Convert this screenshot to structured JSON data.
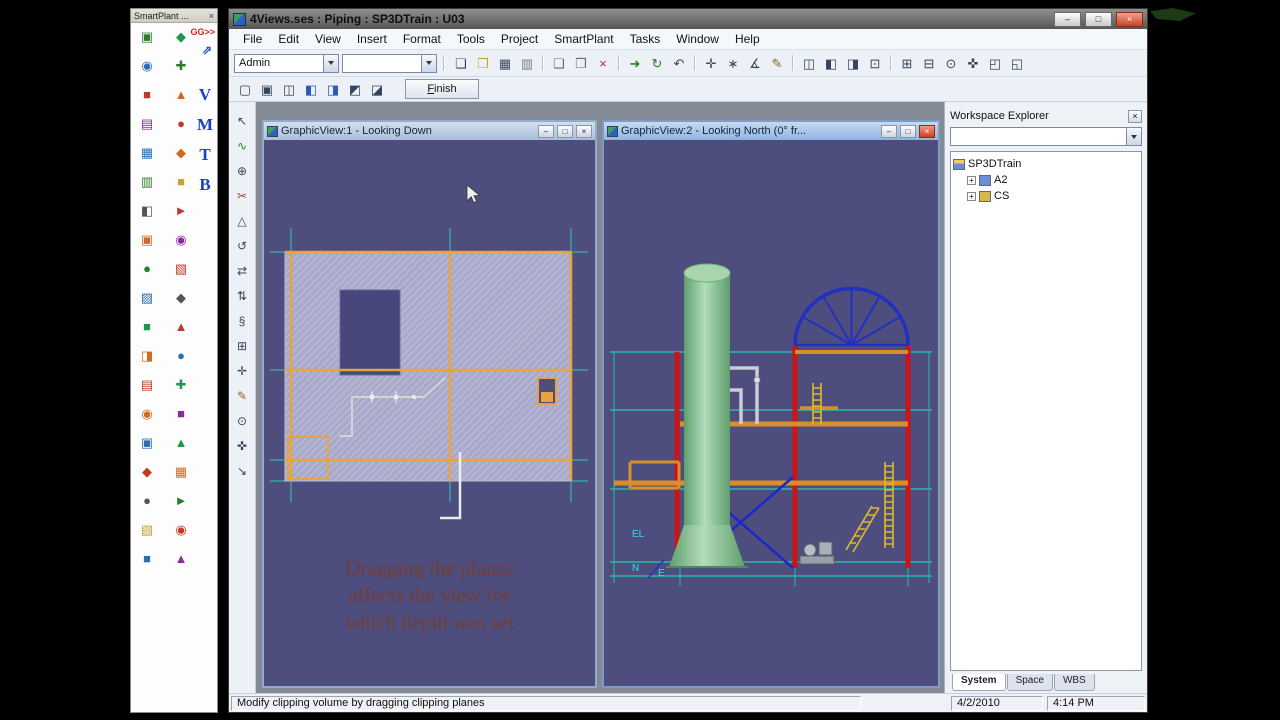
{
  "colors": {
    "canvas_background": "#4e4e7e",
    "accent_orange": "#e8a33d",
    "accent_teal": "#2cb8a8",
    "column_red": "#cc1414",
    "vessel_green": "#8fc49a",
    "dome_blue": "#2230c0",
    "overlay_text": "#7a3a2a"
  },
  "chrome": {
    "minimize": "–",
    "maximize": "□",
    "close": "×"
  },
  "palette": {
    "title": "SmartPlant ...",
    "gg_label": "GG>>",
    "jump_glyph": "⇗",
    "letters": [
      "V",
      "M",
      "T",
      "B"
    ],
    "icons": [
      {
        "g": "▣",
        "c": "#2a7d2a"
      },
      {
        "g": "◆",
        "c": "#1a9a4a"
      },
      {
        "g": "◉",
        "c": "#2a6db5"
      },
      {
        "g": "✚",
        "c": "#2a7d2a"
      },
      {
        "g": "■",
        "c": "#c03a2a"
      },
      {
        "g": "▲",
        "c": "#d2691e"
      },
      {
        "g": "▤",
        "c": "#8a2aa0"
      },
      {
        "g": "●",
        "c": "#c03a2a"
      },
      {
        "g": "▦",
        "c": "#2a6db5"
      },
      {
        "g": "◆",
        "c": "#d2691e"
      },
      {
        "g": "▥",
        "c": "#2a7d2a"
      },
      {
        "g": "■",
        "c": "#c9a23b"
      },
      {
        "g": "◧",
        "c": "#555555"
      },
      {
        "g": "►",
        "c": "#c03a2a"
      },
      {
        "g": "▣",
        "c": "#d2691e"
      },
      {
        "g": "◉",
        "c": "#8a2aa0"
      },
      {
        "g": "●",
        "c": "#2a7d2a"
      },
      {
        "g": "▧",
        "c": "#c03a2a"
      },
      {
        "g": "▨",
        "c": "#2a6db5"
      },
      {
        "g": "◆",
        "c": "#555555"
      },
      {
        "g": "■",
        "c": "#1a9a4a"
      },
      {
        "g": "▲",
        "c": "#c03a2a"
      },
      {
        "g": "◨",
        "c": "#d2691e"
      },
      {
        "g": "●",
        "c": "#2a6db5"
      },
      {
        "g": "▤",
        "c": "#c03a2a"
      },
      {
        "g": "✚",
        "c": "#1a9a4a"
      },
      {
        "g": "◉",
        "c": "#d2691e"
      },
      {
        "g": "■",
        "c": "#8a2aa0"
      },
      {
        "g": "▣",
        "c": "#2a6db5"
      },
      {
        "g": "▲",
        "c": "#1a9a4a"
      },
      {
        "g": "◆",
        "c": "#c03a2a"
      },
      {
        "g": "▦",
        "c": "#d2691e"
      },
      {
        "g": "●",
        "c": "#555555"
      },
      {
        "g": "►",
        "c": "#2a7d2a"
      },
      {
        "g": "▧",
        "c": "#c9a23b"
      },
      {
        "g": "◉",
        "c": "#c03a2a"
      },
      {
        "g": "■",
        "c": "#2a6db5"
      },
      {
        "g": "▲",
        "c": "#8a2aa0"
      }
    ]
  },
  "window": {
    "title": "4Views.ses : Piping : SP3DTrain : U03"
  },
  "menu": {
    "items": [
      "File",
      "Edit",
      "View",
      "Insert",
      "Format",
      "Tools",
      "Project",
      "SmartPlant",
      "Tasks",
      "Window",
      "Help"
    ]
  },
  "toolbars": {
    "permission_group": "Admin",
    "locate_filter": "",
    "finish": "Finish",
    "main_icons": [
      {
        "name": "new-document",
        "g": "❏",
        "c": "#35455e"
      },
      {
        "name": "open",
        "g": "❐",
        "c": "#c9a23b"
      },
      {
        "name": "save",
        "g": "▦",
        "c": "#35455e"
      },
      {
        "name": "print",
        "g": "▥",
        "c": "#6a7a94"
      },
      {
        "sep": true
      },
      {
        "name": "copy",
        "g": "❑",
        "c": "#5b6b85"
      },
      {
        "name": "paste",
        "g": "❒",
        "c": "#5b6b85"
      },
      {
        "name": "delete",
        "g": "×",
        "c": "#aa3333"
      },
      {
        "sep": true
      },
      {
        "name": "move",
        "g": "➜",
        "c": "#2a7d2a"
      },
      {
        "name": "rotate",
        "g": "↻",
        "c": "#2a7d2a"
      },
      {
        "name": "undo",
        "g": "↶",
        "c": "#35455e"
      },
      {
        "sep": true
      },
      {
        "name": "pinpoint",
        "g": "✛",
        "c": "#35455e"
      },
      {
        "name": "point-along",
        "g": "∗",
        "c": "#35455e"
      },
      {
        "name": "measure",
        "g": "∡",
        "c": "#35455e"
      },
      {
        "name": "sketch",
        "g": "✎",
        "c": "#8a6a2a"
      },
      {
        "sep": true
      },
      {
        "name": "view-properties",
        "g": "◫",
        "c": "#35455e"
      },
      {
        "name": "split-view",
        "g": "◧",
        "c": "#35455e"
      },
      {
        "name": "window-layout",
        "g": "◨",
        "c": "#35455e"
      },
      {
        "name": "view-box",
        "g": "⊡",
        "c": "#35455e"
      },
      {
        "sep": true
      },
      {
        "name": "zoom-in",
        "g": "⊞",
        "c": "#35455e"
      },
      {
        "name": "zoom-out",
        "g": "⊟",
        "c": "#35455e"
      },
      {
        "name": "zoom-tool",
        "g": "⊙",
        "c": "#35455e"
      },
      {
        "name": "pan",
        "g": "✜",
        "c": "#35455e"
      },
      {
        "name": "fit-view",
        "g": "◰",
        "c": "#35455e"
      },
      {
        "name": "previous-view",
        "g": "◱",
        "c": "#35455e"
      }
    ],
    "view_icons": [
      {
        "name": "clip-option-1",
        "g": "▢",
        "c": "#35455e"
      },
      {
        "name": "clip-option-2",
        "g": "▣",
        "c": "#35455e"
      },
      {
        "name": "clip-option-3",
        "g": "◫",
        "c": "#35455e"
      },
      {
        "name": "clip-option-4",
        "g": "◧",
        "c": "#2a5db0"
      },
      {
        "name": "clip-option-5",
        "g": "◨",
        "c": "#2a5db0"
      },
      {
        "name": "clip-option-6",
        "g": "◩",
        "c": "#35455e"
      },
      {
        "name": "clip-option-7",
        "g": "◪",
        "c": "#35455e"
      }
    ],
    "vertical_icons": [
      {
        "name": "select-tool",
        "g": "↖",
        "c": "#35455e"
      },
      {
        "name": "route-pipe",
        "g": "∿",
        "c": "#2a7d2a"
      },
      {
        "name": "insert-component",
        "g": "⊕",
        "c": "#35455e"
      },
      {
        "name": "insert-split",
        "g": "✂",
        "c": "#a04028"
      },
      {
        "name": "surface-mount",
        "g": "△",
        "c": "#35455e"
      },
      {
        "name": "rotate-tool",
        "g": "↺",
        "c": "#35455e"
      },
      {
        "name": "move-tool",
        "g": "⇄",
        "c": "#35455e"
      },
      {
        "name": "elevation-tool",
        "g": "⇅",
        "c": "#35455e"
      },
      {
        "name": "section-tool",
        "g": "§",
        "c": "#35455e"
      },
      {
        "name": "grid-tool",
        "g": "⊞",
        "c": "#35455e"
      },
      {
        "name": "crosshair-tool",
        "g": "✛",
        "c": "#35455e"
      },
      {
        "name": "sketch-3d",
        "g": "✎",
        "c": "#8a6a2a"
      },
      {
        "name": "zoom-tool-2",
        "g": "⊙",
        "c": "#35455e"
      },
      {
        "name": "pan-tool",
        "g": "✜",
        "c": "#35455e"
      },
      {
        "name": "direction-tool",
        "g": "↘",
        "c": "#35455e"
      }
    ]
  },
  "views": [
    {
      "title": "GraphicView:1 - Looking Down",
      "overlay": [
        "Dragging the planes",
        "affects the view for",
        "which depth was set"
      ]
    },
    {
      "title": "GraphicView:2 - Looking North (0° fr...",
      "labels": {
        "el": "EL",
        "n": "N",
        "e": "E"
      }
    }
  ],
  "explorer": {
    "title": "Workspace Explorer",
    "expander": "+",
    "tree": {
      "root": "SP3DTrain",
      "children": [
        {
          "label": "A2",
          "icon_color": "#6a8fd8"
        },
        {
          "label": "CS",
          "icon_color": "#d8b84a"
        }
      ]
    },
    "tabs": [
      "System",
      "Space",
      "WBS"
    ]
  },
  "statusbar": {
    "message": "Modify clipping volume by dragging clipping planes",
    "date": "4/2/2010",
    "time": "4:14 PM"
  }
}
